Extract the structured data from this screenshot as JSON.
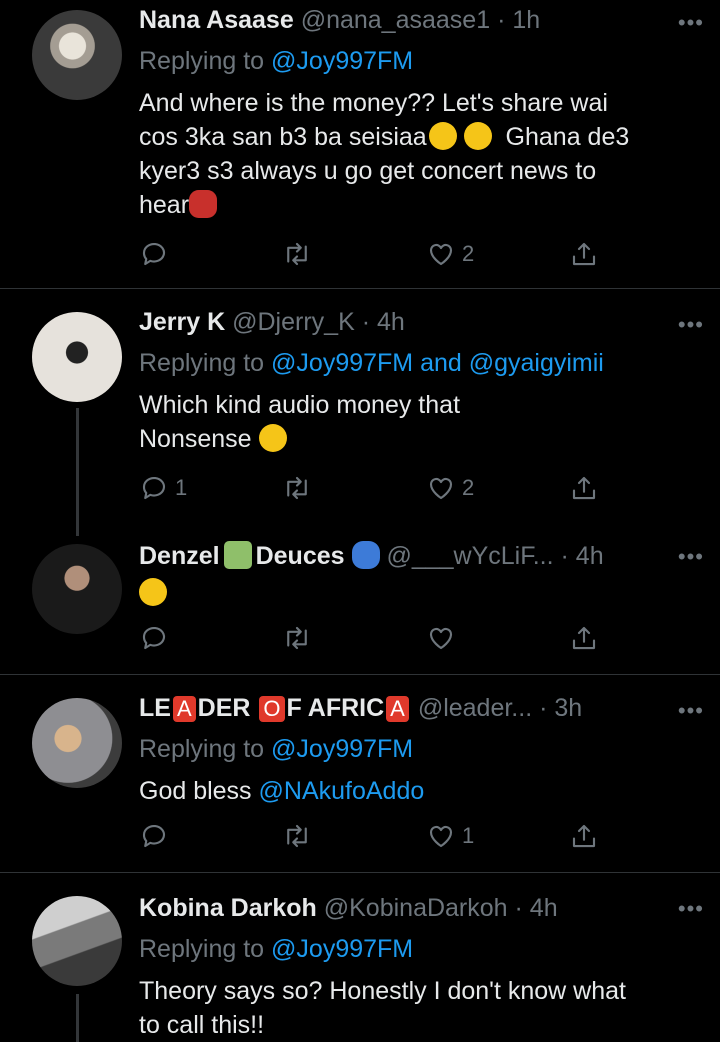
{
  "tweets": [
    {
      "name": "Nana Asaase",
      "handle": "@nana_asaase1",
      "time": "· 1h",
      "reply_prefix": "Replying to ",
      "reply_to": "@Joy997FM",
      "text_lines": [
        "And where is the money?? Let's share wai",
        "cos 3ka san b3 ba seisiaa",
        "Ghana de3",
        "kyer3 s3 always u go get concert news to",
        "hear"
      ],
      "reply_count": "",
      "retweet_count": "",
      "like_count": "2"
    },
    {
      "name": "Jerry K",
      "handle": "@Djerry_K",
      "time": "· 4h",
      "reply_prefix": "Replying to ",
      "reply_to": "@Joy997FM and @gyaigyimii",
      "text_lines": [
        "Which kind audio money that",
        "Nonsense"
      ],
      "reply_count": "1",
      "retweet_count": "",
      "like_count": "2"
    },
    {
      "name_part1": "Denzel",
      "name_part2": "Deuces",
      "handle": "@___wYcLiF...",
      "time": "· 4h",
      "reply_count": "",
      "retweet_count": "",
      "like_count": ""
    },
    {
      "name_parts": [
        "LE",
        "A",
        "DER ",
        "O",
        "F AFRIC",
        "A"
      ],
      "handle": "@leader...",
      "time": "· 3h",
      "reply_prefix": "Replying to ",
      "reply_to": "@Joy997FM",
      "text": "God bless ",
      "text_mention": "@NAkufoAddo",
      "reply_count": "",
      "retweet_count": "",
      "like_count": "1"
    },
    {
      "name": "Kobina Darkoh",
      "handle": "@KobinaDarkoh",
      "time": "· 4h",
      "reply_prefix": "Replying to ",
      "reply_to": "@Joy997FM",
      "text_lines": [
        "Theory says so? Honestly I don't know what",
        "to call this!!"
      ]
    }
  ],
  "more_label": "•••",
  "icons": {
    "reply": "reply-icon",
    "retweet": "retweet-icon",
    "like": "heart-icon",
    "share": "share-icon",
    "more": "more-options-icon"
  },
  "colors": {
    "background": "#000000",
    "link": "#1d9bf0",
    "muted": "#6e767d",
    "text": "#e7e9ea"
  }
}
